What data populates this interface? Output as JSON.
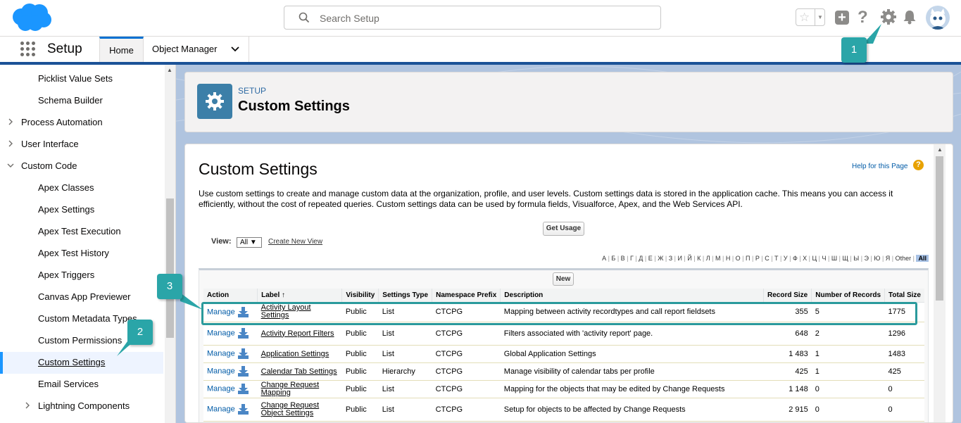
{
  "search": {
    "placeholder": "Search Setup"
  },
  "nav": {
    "app_title": "Setup",
    "tab_home": "Home",
    "tab_object_manager": "Object Manager"
  },
  "sidebar": {
    "items": [
      {
        "label": "Picklist Value Sets",
        "indent": 2
      },
      {
        "label": "Schema Builder",
        "indent": 2
      },
      {
        "label": "Process Automation",
        "indent": 1,
        "chevron": "right"
      },
      {
        "label": "User Interface",
        "indent": 1,
        "chevron": "right"
      },
      {
        "label": "Custom Code",
        "indent": 1,
        "chevron": "down"
      },
      {
        "label": "Apex Classes",
        "indent": 2
      },
      {
        "label": "Apex Settings",
        "indent": 2
      },
      {
        "label": "Apex Test Execution",
        "indent": 2
      },
      {
        "label": "Apex Test History",
        "indent": 2
      },
      {
        "label": "Apex Triggers",
        "indent": 2
      },
      {
        "label": "Canvas App Previewer",
        "indent": 2
      },
      {
        "label": "Custom Metadata Types",
        "indent": 2
      },
      {
        "label": "Custom Permissions",
        "indent": 2
      },
      {
        "label": "Custom Settings",
        "indent": 2,
        "selected": true
      },
      {
        "label": "Email Services",
        "indent": 2
      },
      {
        "label": "Lightning Components",
        "indent": 2,
        "chevron": "right"
      }
    ]
  },
  "header": {
    "eyebrow": "SETUP",
    "title": "Custom Settings"
  },
  "content": {
    "title": "Custom Settings",
    "help_link": "Help for this Page",
    "help_icon": "?",
    "description": "Use custom settings to create and manage custom data at the organization, profile, and user levels. Custom settings data is stored in the application cache. This means you can access it efficiently, without the cost of repeated queries. Custom settings data can be used by formula fields, Visualforce, Apex, and the Web Services API.",
    "get_usage_button": "Get Usage",
    "view_label": "View:",
    "view_value": "All",
    "create_new_view": "Create New View",
    "alphabet": [
      "А",
      "Б",
      "В",
      "Г",
      "Д",
      "Е",
      "Ж",
      "З",
      "И",
      "Й",
      "К",
      "Л",
      "М",
      "Н",
      "О",
      "П",
      "Р",
      "С",
      "Т",
      "У",
      "Ф",
      "Х",
      "Ц",
      "Ч",
      "Ш",
      "Щ",
      "Ы",
      "Э",
      "Ю",
      "Я",
      "Other",
      "All"
    ],
    "new_button": "New"
  },
  "table": {
    "columns": [
      "Action",
      "Label ↑",
      "Visibility",
      "Settings Type",
      "Namespace Prefix",
      "Description",
      "Record Size",
      "Number of Records",
      "Total Size"
    ],
    "rows": [
      {
        "action": "Manage",
        "label": "Activity Layout Settings",
        "visibility": "Public",
        "type": "List",
        "prefix": "CTCPG",
        "description": "Mapping between activity recordtypes and call report fieldsets",
        "record_size": "355",
        "count": "5",
        "total": "1775"
      },
      {
        "action": "Manage",
        "label": "Activity Report Filters",
        "visibility": "Public",
        "type": "List",
        "prefix": "CTCPG",
        "description": "Filters associated with 'activity report' page.",
        "record_size": "648",
        "count": "2",
        "total": "1296"
      },
      {
        "action": "Manage",
        "label": "Application Settings",
        "visibility": "Public",
        "type": "List",
        "prefix": "CTCPG",
        "description": "Global Application Settings",
        "record_size": "1 483",
        "count": "1",
        "total": "1483"
      },
      {
        "action": "Manage",
        "label": "Calendar Tab Settings",
        "visibility": "Public",
        "type": "Hierarchy",
        "prefix": "CTCPG",
        "description": "Manage visibility of calendar tabs per profile",
        "record_size": "425",
        "count": "1",
        "total": "425"
      },
      {
        "action": "Manage",
        "label": "Change Request Mapping",
        "visibility": "Public",
        "type": "List",
        "prefix": "CTCPG",
        "description": "Mapping for the objects that may be edited by Change Requests",
        "record_size": "1 148",
        "count": "0",
        "total": "0"
      },
      {
        "action": "Manage",
        "label": "Change Request Object Settings",
        "visibility": "Public",
        "type": "List",
        "prefix": "CTCPG",
        "description": "Setup for objects to be affected by Change Requests",
        "record_size": "2 915",
        "count": "0",
        "total": "0"
      }
    ]
  },
  "callouts": {
    "one": "1",
    "two": "2",
    "three": "3"
  },
  "colors": {
    "brand_blue": "#0070d2",
    "callout_teal": "#2aa5a8",
    "setup_icon": "#3c7fa8",
    "link": "#015ba7"
  }
}
